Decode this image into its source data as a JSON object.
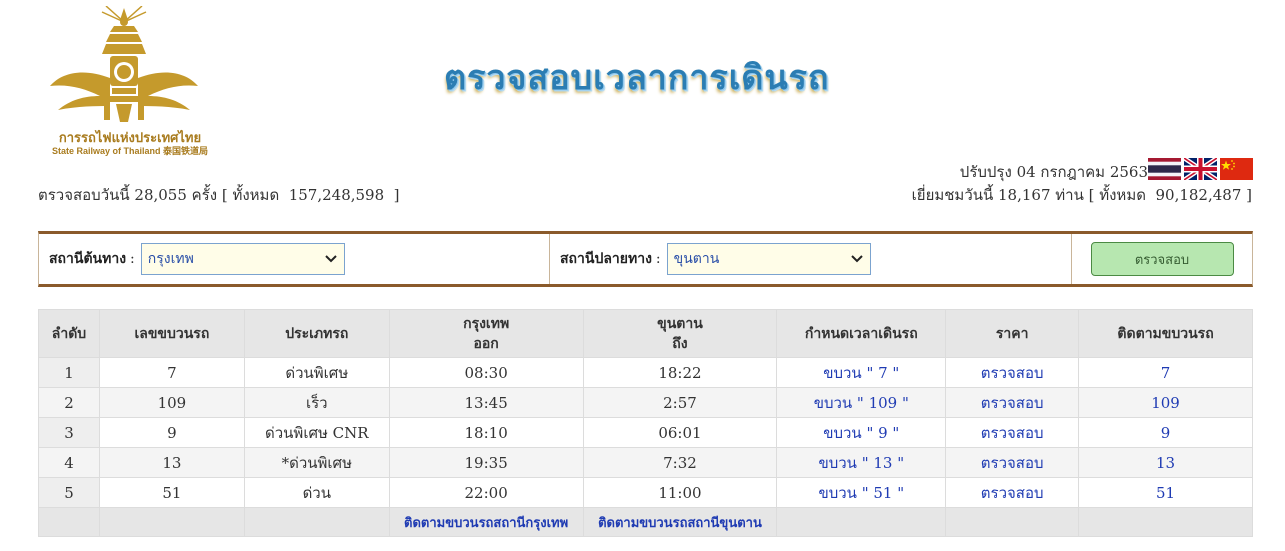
{
  "header": {
    "logo_th": "การรถไฟแห่งประเทศไทย",
    "logo_en": "State Railway of Thailand 泰国铁道局",
    "title": "ตรวจสอบเวลาการเดินรถ",
    "updated": "ปรับปรุง 04 กรกฎาคม 2563",
    "stats_left": "ตรวจสอบวันนี้ 28,055 ครั้ง [ ทั้งหมด  157,248,598  ]",
    "stats_right": "เยี่ยมชมวันนี้ 18,167 ท่าน [ ทั้งหมด  90,182,487 ]",
    "flags": [
      "thai-flag",
      "uk-flag",
      "china-flag"
    ]
  },
  "search": {
    "origin_label": "สถานีต้นทาง",
    "origin_value": "กรุงเทพ",
    "dest_label": "สถานีปลายทาง",
    "dest_value": "ขุนตาน",
    "colon": ":",
    "button": "ตรวจสอบ"
  },
  "table": {
    "headers": {
      "idx": "ลำดับ",
      "train_no": "เลขขบวนรถ",
      "type": "ประเภทรถ",
      "depart_station": "กรุงเทพ",
      "depart": "ออก",
      "arrive_station": "ขุนตาน",
      "arrive": "ถึง",
      "schedule": "กำหนดเวลาเดินรถ",
      "price": "ราคา",
      "track": "ติดตามขบวนรถ"
    },
    "rows": [
      {
        "idx": "1",
        "train_no": "7",
        "type": "ด่วนพิเศษ",
        "depart": "08:30",
        "arrive": "18:22",
        "schedule": "ขบวน \" 7 \"",
        "price": "ตรวจสอบ",
        "track": "7"
      },
      {
        "idx": "2",
        "train_no": "109",
        "type": "เร็ว",
        "depart": "13:45",
        "arrive": "2:57",
        "schedule": "ขบวน \" 109 \"",
        "price": "ตรวจสอบ",
        "track": "109"
      },
      {
        "idx": "3",
        "train_no": "9",
        "type": "ด่วนพิเศษ CNR",
        "depart": "18:10",
        "arrive": "06:01",
        "schedule": "ขบวน \" 9 \"",
        "price": "ตรวจสอบ",
        "track": "9"
      },
      {
        "idx": "4",
        "train_no": "13",
        "type": "*ด่วนพิเศษ",
        "depart": "19:35",
        "arrive": "7:32",
        "schedule": "ขบวน \" 13 \"",
        "price": "ตรวจสอบ",
        "track": "13"
      },
      {
        "idx": "5",
        "train_no": "51",
        "type": "ด่วน",
        "depart": "22:00",
        "arrive": "11:00",
        "schedule": "ขบวน \" 51 \"",
        "price": "ตรวจสอบ",
        "track": "51"
      }
    ],
    "footer": {
      "track_origin": "ติดตามขบวนรถสถานีกรุงเทพ",
      "track_dest": "ติดตามขบวนรถสถานีขุนตาน"
    }
  }
}
